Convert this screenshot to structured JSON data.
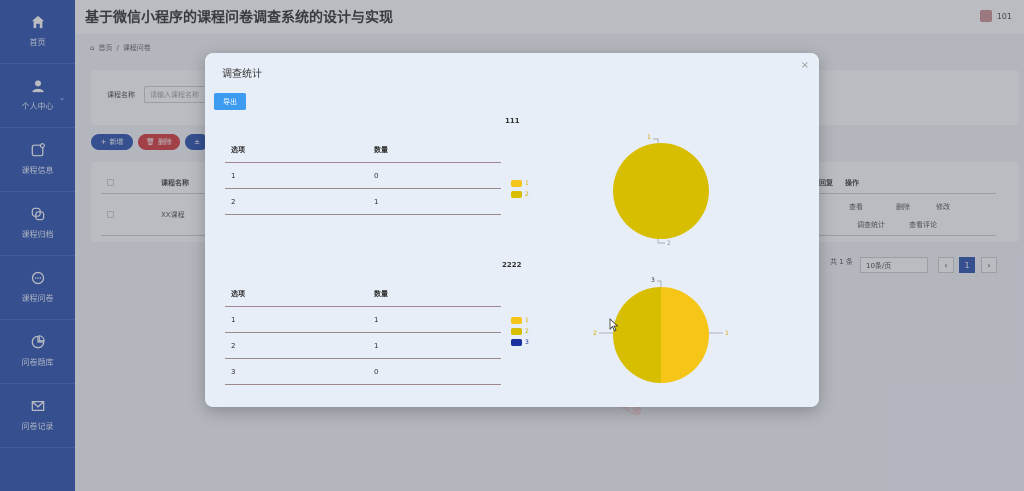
{
  "app": {
    "title": "基于微信小程序的课程问卷调查系统的设计与实现",
    "user": "101"
  },
  "sidebar": {
    "items": [
      {
        "label": "首页",
        "icon": "home-icon"
      },
      {
        "label": "个人中心",
        "icon": "user-icon"
      },
      {
        "label": "课程信息",
        "icon": "course-info-icon"
      },
      {
        "label": "课程归档",
        "icon": "archive-icon"
      },
      {
        "label": "课程问卷",
        "icon": "chat-icon"
      },
      {
        "label": "问卷题库",
        "icon": "pie-icon"
      },
      {
        "label": "问卷记录",
        "icon": "mail-icon"
      }
    ]
  },
  "breadcrumb": {
    "home": "首页",
    "sep": "/",
    "current": "课程问卷"
  },
  "search": {
    "label": "课程名称",
    "placeholder": "请输入课程名称"
  },
  "toolbar": {
    "add": "新增",
    "delete": "删除",
    "other": "±"
  },
  "table": {
    "col_name": "课程名称",
    "col_reply": "回复",
    "col_ops": "操作",
    "row_name": "XX课程",
    "ops": [
      "查看",
      "删除",
      "修改",
      "调查统计",
      "查看评论"
    ]
  },
  "pager": {
    "total": "共 1 条",
    "size": "10条/页",
    "prev": "‹",
    "page": "1",
    "next": "›"
  },
  "watermark": "源码好优多",
  "modal": {
    "title": "调查统计",
    "close": "×",
    "export": "导出",
    "col_option": "选项",
    "col_count": "数量",
    "questions": [
      {
        "title": "111",
        "rows": [
          {
            "option": "1",
            "count": "0"
          },
          {
            "option": "2",
            "count": "1"
          }
        ],
        "legend": [
          {
            "label": "1",
            "color": "#f5c518"
          },
          {
            "label": "2",
            "color": "#d8be00"
          }
        ],
        "pie_labels": [
          "1",
          "2"
        ]
      },
      {
        "title": "2222",
        "rows": [
          {
            "option": "1",
            "count": "1"
          },
          {
            "option": "2",
            "count": "1"
          },
          {
            "option": "3",
            "count": "0"
          }
        ],
        "legend": [
          {
            "label": "1",
            "color": "#f5c518"
          },
          {
            "label": "2",
            "color": "#d8be00"
          },
          {
            "label": "3",
            "color": "#1a2fa0"
          }
        ],
        "pie_labels": [
          "1",
          "2",
          "3"
        ]
      }
    ]
  },
  "chart_data": [
    {
      "type": "pie",
      "title": "111",
      "categories": [
        "1",
        "2"
      ],
      "values": [
        0,
        1
      ],
      "colors": [
        "#f5c518",
        "#d8be00"
      ]
    },
    {
      "type": "pie",
      "title": "2222",
      "categories": [
        "1",
        "2",
        "3"
      ],
      "values": [
        1,
        1,
        0
      ],
      "colors": [
        "#f5c518",
        "#d8be00",
        "#1a2fa0"
      ]
    }
  ]
}
